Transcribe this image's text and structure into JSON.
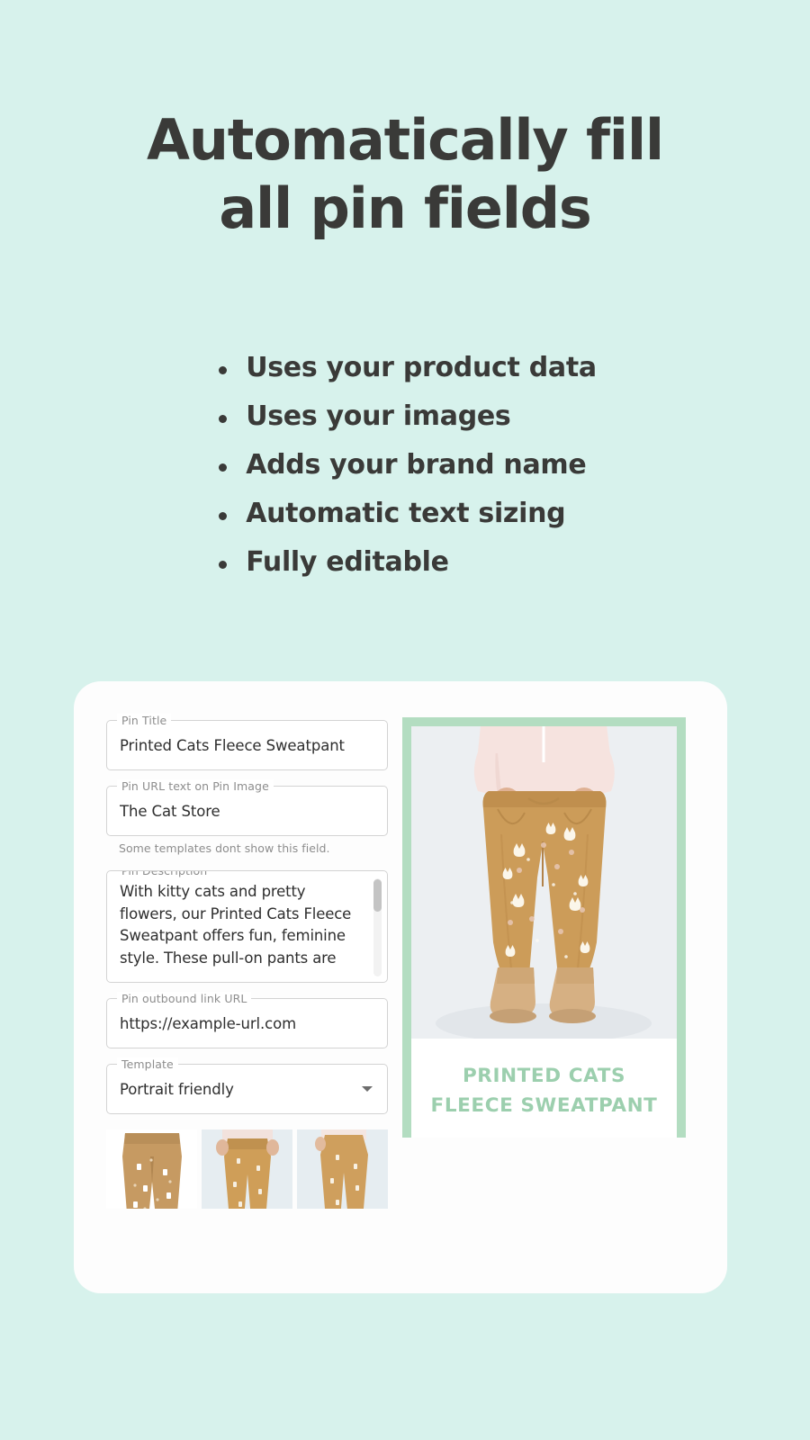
{
  "hero": {
    "heading_line1": "Automatically fill",
    "heading_line2": "all pin fields",
    "text_color": "#3a3a38",
    "background_color": "#d7f2ec"
  },
  "features": {
    "items": [
      {
        "label": "Uses your product data"
      },
      {
        "label": "Uses your images"
      },
      {
        "label": "Adds your brand name"
      },
      {
        "label": "Automatic text sizing"
      },
      {
        "label": "Fully editable"
      }
    ]
  },
  "app": {
    "form": {
      "pin_title": {
        "label": "Pin Title",
        "value": "Printed Cats Fleece Sweatpant"
      },
      "pin_url_text": {
        "label": "Pin URL text on Pin Image",
        "value": "The Cat Store",
        "helper": "Some templates dont show this field."
      },
      "pin_description": {
        "label": "Pin Description",
        "value": "With kitty cats and pretty flowers, our Printed Cats Fleece Sweatpant offers fun, feminine style. These pull-on pants are made from soft"
      },
      "pin_outbound_url": {
        "label": "Pin outbound link URL",
        "value": "https://example-url.com"
      },
      "template": {
        "label": "Template",
        "value": "Portrait friendly",
        "icon": "chevron-down-icon"
      }
    },
    "thumbnails": [
      {
        "alt_text": "Printed Cats Fleece Sweatpant flat lay"
      },
      {
        "alt_text": "Printed Cats Fleece Sweatpant front view"
      },
      {
        "alt_text": "Printed Cats Fleece Sweatpant side view"
      }
    ],
    "preview": {
      "caption_line1": "Printed Cats",
      "caption_line2": "Fleece Sweatpant",
      "border_color": "#b3ddc1",
      "caption_color": "#9ccfae"
    }
  }
}
